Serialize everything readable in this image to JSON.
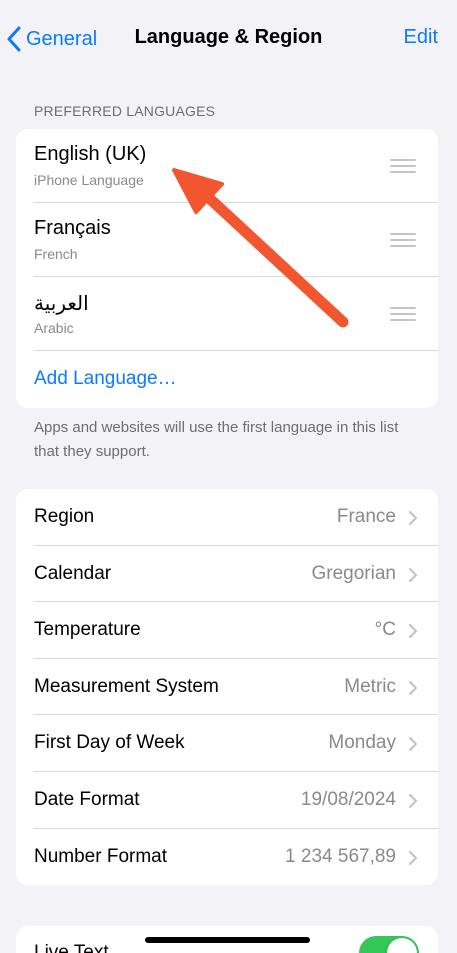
{
  "nav": {
    "back_label": "General",
    "title": "Language & Region",
    "edit_label": "Edit"
  },
  "preferred_languages": {
    "header": "PREFERRED LANGUAGES",
    "items": [
      {
        "name": "English (UK)",
        "subtitle": "iPhone Language"
      },
      {
        "name": "Français",
        "subtitle": "French"
      },
      {
        "name": "العربية",
        "subtitle": "Arabic"
      }
    ],
    "add_label": "Add Language…",
    "footer": "Apps and websites will use the first language in this list that they support."
  },
  "region_settings": [
    {
      "label": "Region",
      "value": "France"
    },
    {
      "label": "Calendar",
      "value": "Gregorian"
    },
    {
      "label": "Temperature",
      "value": "°C"
    },
    {
      "label": "Measurement System",
      "value": "Metric"
    },
    {
      "label": "First Day of Week",
      "value": "Monday"
    },
    {
      "label": "Date Format",
      "value": "19/08/2024"
    },
    {
      "label": "Number Format",
      "value": "1 234 567,89"
    }
  ],
  "live_text": {
    "label": "Live Text",
    "enabled": true
  },
  "colors": {
    "accent": "#0a7aff",
    "annotation_arrow": "#f2562f",
    "toggle_on": "#34c759",
    "background": "#f2f2f7"
  },
  "icons": [
    "chevron-left-icon",
    "reorder-handle-icon",
    "chevron-right-icon",
    "annotation-arrow"
  ]
}
